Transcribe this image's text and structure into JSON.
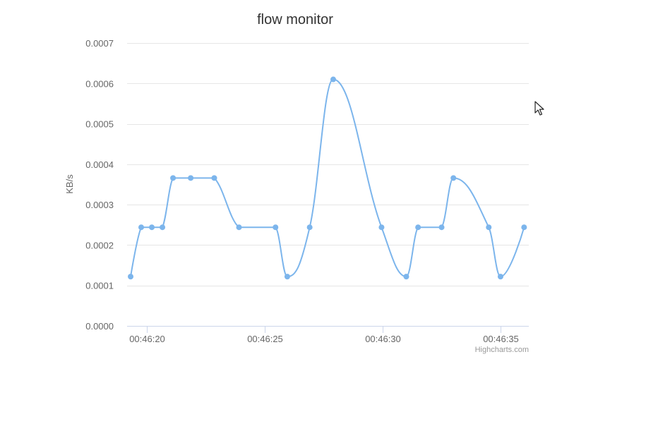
{
  "colors": {
    "series": "#7cb5ec",
    "grid": "#e6e6e6",
    "axis": "#ccd6eb"
  },
  "cursor": {
    "icon": "arrow-pointer-icon"
  },
  "chart_data": {
    "type": "line",
    "title": "flow monitor",
    "xlabel": "",
    "ylabel": "KB/s",
    "credits": "Highcharts.com",
    "grid": true,
    "legend": "none",
    "smooth": true,
    "xlim": [
      "00:46:19.15",
      "00:46:36.2"
    ],
    "ylim": [
      0,
      0.0007
    ],
    "yticks": [
      0.0,
      0.0001,
      0.0002,
      0.0003,
      0.0004,
      0.0005,
      0.0006,
      0.0007
    ],
    "ytick_labels": [
      "0.0000",
      "0.0001",
      "0.0002",
      "0.0003",
      "0.0004",
      "0.0005",
      "0.0006",
      "0.0007"
    ],
    "xticks": [
      "00:46:20",
      "00:46:25",
      "00:46:30",
      "00:46:35"
    ],
    "series": [
      {
        "x": [
          "00:46:19.3",
          "00:46:19.75",
          "00:46:20.2",
          "00:46:20.65",
          "00:46:21.1",
          "00:46:21.85",
          "00:46:22.85",
          "00:46:23.9",
          "00:46:25.45",
          "00:46:25.95",
          "00:46:26.9",
          "00:46:27.9",
          "00:46:29.95",
          "00:46:31.0",
          "00:46:31.5",
          "00:46:32.5",
          "00:46:33.0",
          "00:46:34.5",
          "00:46:35.0",
          "00:46:36.0"
        ],
        "values": [
          0.000122,
          0.000244,
          0.000244,
          0.000244,
          0.000366,
          0.000366,
          0.000366,
          0.000244,
          0.000244,
          0.000122,
          0.000244,
          0.00061,
          0.000244,
          0.000122,
          0.000244,
          0.000244,
          0.000366,
          0.000244,
          0.000122,
          0.000244
        ]
      }
    ]
  }
}
